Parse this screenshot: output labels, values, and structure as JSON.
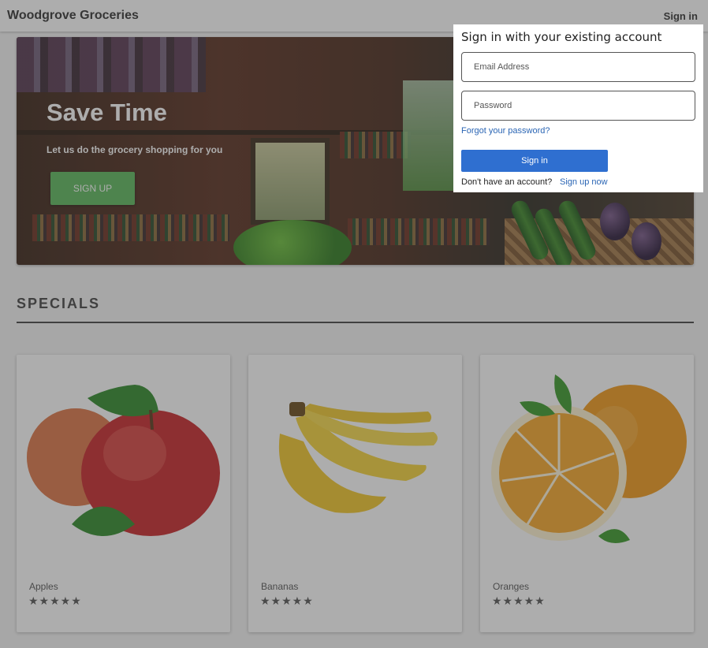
{
  "header": {
    "brand": "Woodgrove Groceries",
    "signin_label": "Sign in"
  },
  "hero": {
    "title": "Save Time",
    "subtitle": "Let us do the grocery shopping for you",
    "button_label": "SIGN UP"
  },
  "specials": {
    "title": "SPECIALS",
    "products": [
      {
        "name": "Apples",
        "rating": 5,
        "stars": "★★★★★"
      },
      {
        "name": "Bananas",
        "rating": 5,
        "stars": "★★★★★"
      },
      {
        "name": "Oranges",
        "rating": 5,
        "stars": "★★★★★"
      }
    ]
  },
  "signin_dialog": {
    "title": "Sign in with your existing account",
    "email_placeholder": "Email Address",
    "password_placeholder": "Password",
    "forgot_label": "Forgot your password?",
    "submit_label": "Sign in",
    "no_account_text": "Don't have an account?",
    "signup_label": "Sign up now"
  },
  "colors": {
    "accent_green": "#5cb85c",
    "primary_blue": "#2f6fd0",
    "link_blue": "#2a65b4"
  }
}
